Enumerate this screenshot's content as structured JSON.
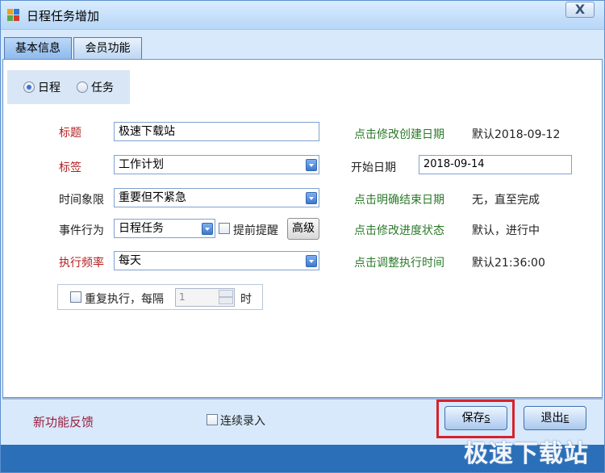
{
  "window": {
    "title": "日程任务增加",
    "close_label": "X"
  },
  "tabs": [
    {
      "label": "基本信息",
      "active": true
    },
    {
      "label": "会员功能",
      "active": false
    }
  ],
  "type_radio": {
    "option_schedule": "日程",
    "option_task": "任务",
    "selected": "日程"
  },
  "form": {
    "title_label": "标题",
    "title_value": "极速下载站",
    "tag_label": "标签",
    "tag_value": "工作计划",
    "quadrant_label": "时间象限",
    "quadrant_value": "重要但不紧急",
    "behavior_label": "事件行为",
    "behavior_value": "日程任务",
    "reminder_label": "提前提醒",
    "advanced_label": "高级",
    "frequency_label": "执行频率",
    "frequency_value": "每天",
    "repeat_label": "重复执行，每隔",
    "repeat_value": "1",
    "repeat_unit": "时"
  },
  "right_panel": {
    "created_link": "点击修改创建日期",
    "created_value": "默认2018-09-12",
    "start_label": "开始日期",
    "start_value": "2018-09-14",
    "end_link": "点击明确结束日期",
    "end_value": "无，直至完成",
    "progress_link": "点击修改进度状态",
    "progress_value": "默认，进行中",
    "time_link": "点击调整执行时间",
    "time_value": "默认21:36:00"
  },
  "footer": {
    "feedback_link": "新功能反馈",
    "continuous_label": "连续录入",
    "save_label": "保存",
    "save_hotkey": "S",
    "exit_label": "退出",
    "exit_hotkey": "E"
  },
  "watermark": "极速下载站",
  "colors": {
    "accent_blue": "#2a6fb8",
    "highlight_red": "#d6222c",
    "link_green": "#2a7a2a",
    "label_red": "#b42020"
  }
}
